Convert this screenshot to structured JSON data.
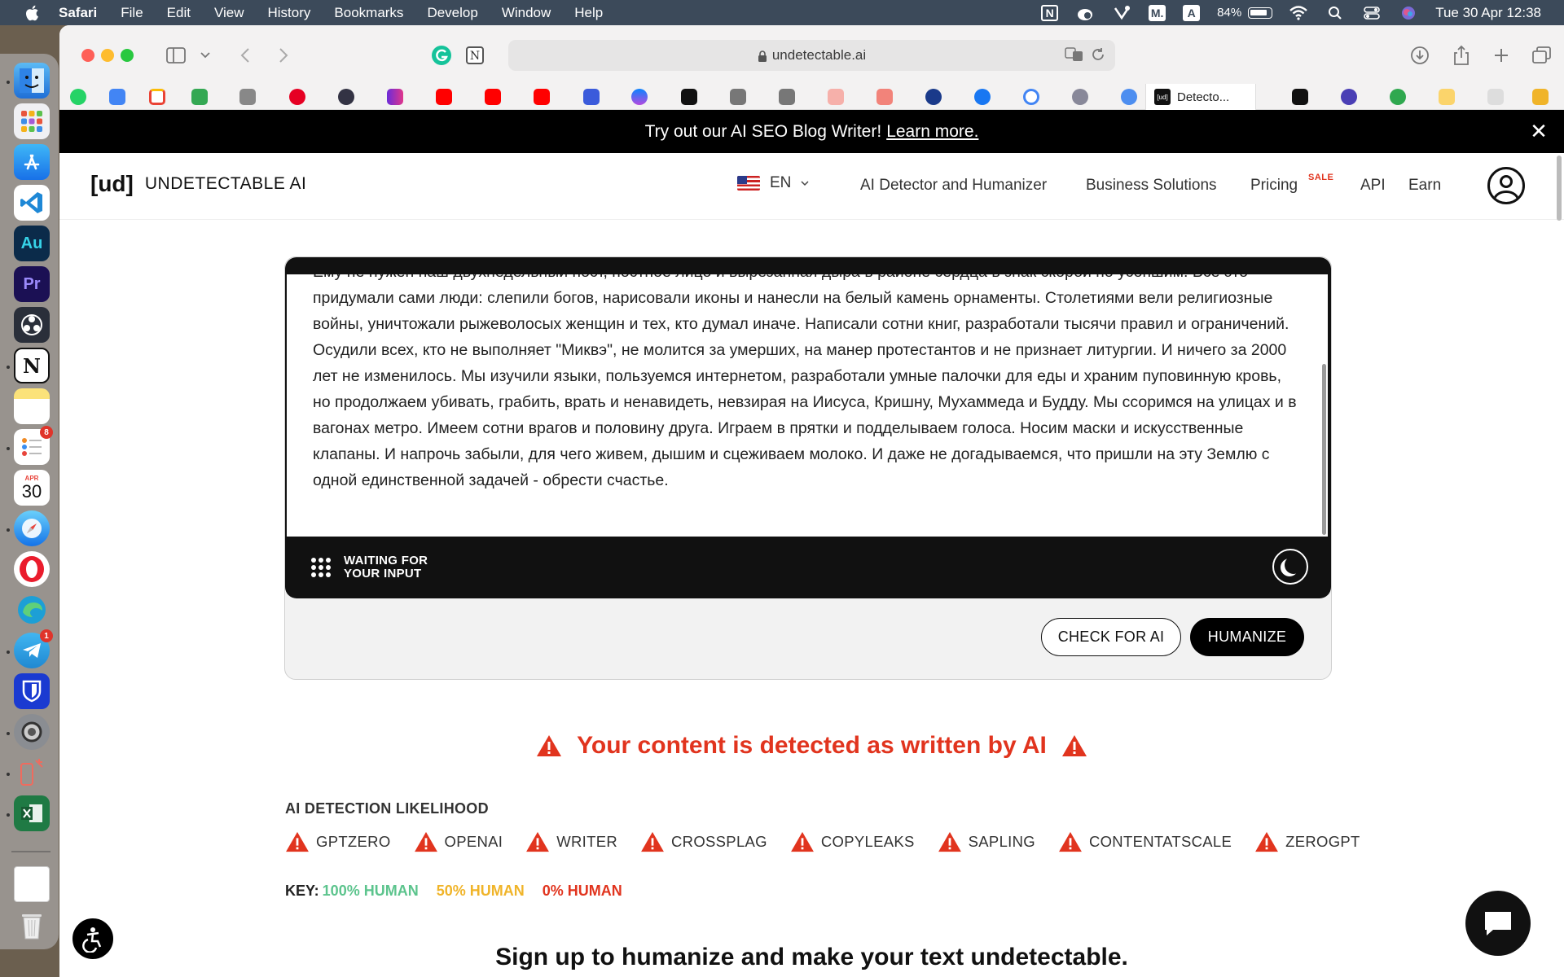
{
  "menubar": {
    "app": "Safari",
    "items": [
      "File",
      "Edit",
      "View",
      "History",
      "Bookmarks",
      "Develop",
      "Window",
      "Help"
    ],
    "battery_percent": "84%",
    "clock": "Tue 30 Apr  12:38"
  },
  "dock": {
    "calendar_month": "APR",
    "calendar_day": "30",
    "reminders_badge": "8",
    "telegram_badge": "1"
  },
  "browser": {
    "url": "undetectable.ai",
    "active_tab": "Detecto..."
  },
  "announcement": {
    "text": "Try out our AI SEO Blog Writer!",
    "link": "Learn more."
  },
  "header": {
    "logo_mark": "[ud]",
    "logo_text": "UNDETECTABLE AI",
    "language": "EN",
    "nav": [
      "AI Detector and Humanizer",
      "Business Solutions",
      "Pricing",
      "API",
      "Earn"
    ],
    "sale_badge": "SALE"
  },
  "editor": {
    "text": "Ему не нужен наш двухнедельный пост, постное лицо и вырезанная дыра в районе сердца в знак скорби по усопшим. Все это придумали сами люди: слепили богов, нарисовали иконы и нанесли на белый камень орнаменты. Столетиями вели религиозные войны, уничтожали рыжеволосых женщин и тех, кто думал иначе. Написали сотни книг, разработали тысячи правил и ограничений. Осудили всех, кто не выполняет \"Миквэ\", не молится за умерших, на манер протестантов и не признает литургии. И ничего за 2000 лет не изменилось. Мы изучили языки, пользуемся интернетом, разработали умные палочки для еды и храним пуповинную кровь, но продолжаем убивать, грабить, врать и ненавидеть, невзирая на Иисуса, Кришну, Мухаммеда и Будду. Мы ссоримся на улицах и в вагонах метро. Имеем сотни врагов и половину друга. Играем в прятки и подделываем голоса. Носим маски и искусственные клапаны. И напрочь забыли, для чего живем, дышим и сцеживаем молоко. И даже не догадываемся, что пришли на эту Землю с одной единственной задачей - обрести счастье.",
    "status_line1": "WAITING FOR",
    "status_line2": "YOUR INPUT",
    "check_button": "CHECK FOR AI",
    "humanize_button": "HUMANIZE"
  },
  "results": {
    "title": "Your content is detected as written by AI",
    "likelihood_label": "AI DETECTION LIKELIHOOD",
    "detectors": [
      "GPTZERO",
      "OPENAI",
      "WRITER",
      "CROSSPLAG",
      "COPYLEAKS",
      "SAPLING",
      "CONTENTATSCALE",
      "ZEROGPT"
    ],
    "key_label": "KEY:",
    "key_human": "100% HUMAN",
    "key_half": "50% HUMAN",
    "key_ai": "0% HUMAN",
    "colors": {
      "human": "#5cc48d",
      "half": "#f0b429",
      "ai": "#e1341e"
    }
  },
  "signup": {
    "text": "Sign up to humanize and make your text undetectable."
  }
}
